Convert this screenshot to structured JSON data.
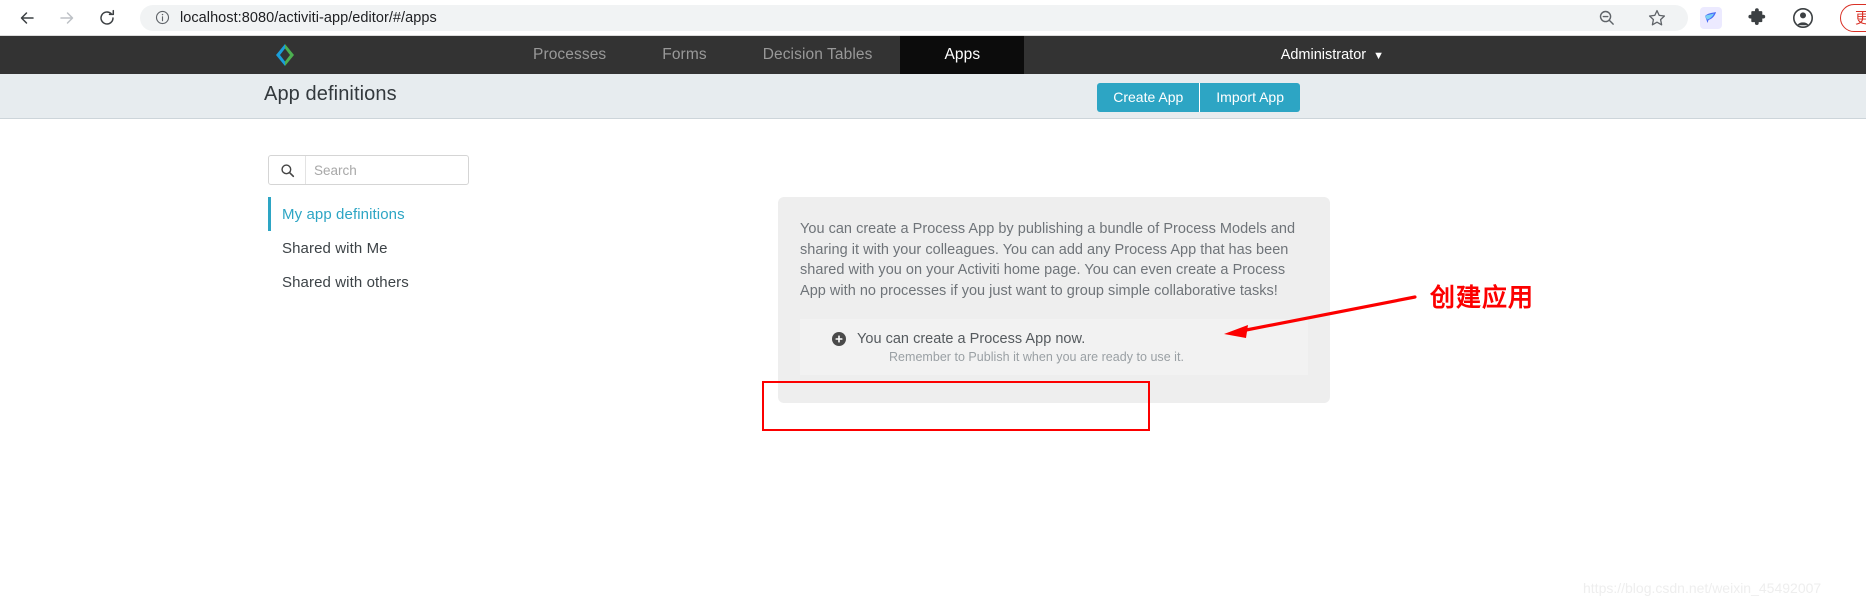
{
  "browser": {
    "back_icon": "arrow-left-icon",
    "forward_icon": "arrow-right-icon",
    "reload_icon": "reload-icon",
    "site_info_icon": "info-circle-icon",
    "url": "localhost:8080/activiti-app/editor/#/apps",
    "url_prefix": "localhost",
    "zoom_icon": "zoom-out-icon",
    "bookmark_icon": "star-icon",
    "extension_badge_icon": "bird-extension-icon",
    "extensions_icon": "puzzle-piece-icon",
    "profile_icon": "account-circle-icon",
    "update_label": "更新"
  },
  "navbar": {
    "logo_icon": "activiti-diamond-logo",
    "logo_colors": {
      "left": "#1a9ed9",
      "right": "#4caf50"
    },
    "tabs": [
      {
        "label": "Processes",
        "active": false
      },
      {
        "label": "Forms",
        "active": false
      },
      {
        "label": "Decision Tables",
        "active": false
      },
      {
        "label": "Apps",
        "active": true
      }
    ],
    "user": "Administrator",
    "user_caret_icon": "chevron-down-icon"
  },
  "header": {
    "title": "App definitions",
    "create_app_label": "Create App",
    "import_app_label": "Import App",
    "button_color": "#2da5c4"
  },
  "search": {
    "icon": "search-icon",
    "placeholder": "Search",
    "value": ""
  },
  "sidebar": {
    "items": [
      {
        "label": "My app definitions",
        "active": true
      },
      {
        "label": "Shared with Me",
        "active": false
      },
      {
        "label": "Shared with others",
        "active": false
      }
    ],
    "active_color": "#2da5c4"
  },
  "main": {
    "intro_paragraph": "You can create a Process App by publishing a bundle of Process Models and sharing it with your colleagues. You can add any Process App that has been shared with you on your Activiti home page. You can even create a Process App with no processes if you just want to group simple collaborative tasks!",
    "create_card": {
      "icon": "plus-circle-icon",
      "title": "You can create a Process App now.",
      "subtitle": "Remember to Publish it when you are ready to use it."
    }
  },
  "annotation": {
    "label": "创建应用",
    "color": "#fc0000",
    "arrow_icon": "arrow-left-annotation"
  },
  "watermark": {
    "text": "https://blog.csdn.net/weixin_45492007"
  }
}
